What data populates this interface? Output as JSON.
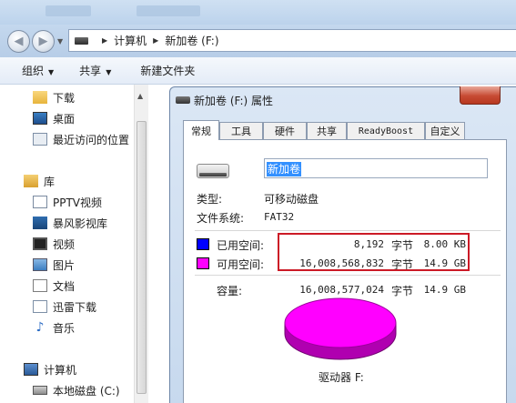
{
  "explorer": {
    "address": {
      "computer": "计算机",
      "drive": "新加卷 (F:)"
    },
    "toolbar": {
      "organize": "组织",
      "share": "共享",
      "new_folder": "新建文件夹"
    },
    "nav": {
      "favorites": [
        {
          "label": "下载",
          "icon": "download-folder-icon"
        },
        {
          "label": "桌面",
          "icon": "desktop-icon"
        },
        {
          "label": "最近访问的位置",
          "icon": "recent-places-icon"
        }
      ],
      "library_label": "库",
      "libraries": [
        {
          "label": "PPTV视频",
          "icon": "pptv-icon"
        },
        {
          "label": "暴风影视库",
          "icon": "storm-library-icon"
        },
        {
          "label": "视频",
          "icon": "video-icon"
        },
        {
          "label": "图片",
          "icon": "pictures-icon"
        },
        {
          "label": "文档",
          "icon": "documents-icon"
        },
        {
          "label": "迅雷下载",
          "icon": "xunlei-icon"
        },
        {
          "label": "音乐",
          "icon": "music-icon"
        }
      ],
      "computer_label": "计算机",
      "drives": [
        {
          "label": "本地磁盘 (C:)",
          "icon": "hard-disk-icon"
        }
      ]
    }
  },
  "dialog": {
    "title": "新加卷 (F:) 属性",
    "tabs": [
      "常规",
      "工具",
      "硬件",
      "共享",
      "ReadyBoost",
      "自定义"
    ],
    "active_tab": "常规",
    "volume_name": "新加卷",
    "type_label": "类型:",
    "type_value": "可移动磁盘",
    "fs_label": "文件系统:",
    "fs_value": "FAT32",
    "used": {
      "label": "已用空间:",
      "bytes": "8,192",
      "unit": "字节",
      "size": "8.00 KB",
      "color": "#0000ff"
    },
    "free": {
      "label": "可用空间:",
      "bytes": "16,008,568,832",
      "unit": "字节",
      "size": "14.9 GB",
      "color": "#ff00ff"
    },
    "capacity": {
      "label": "容量:",
      "bytes": "16,008,577,024",
      "unit": "字节",
      "size": "14.9 GB"
    },
    "drive_label": "驱动器 F:",
    "used_fraction": 5e-07
  },
  "colors": {
    "highlight_box": "#cc1a26",
    "free": "#ff00ff",
    "used": "#0000ff"
  }
}
